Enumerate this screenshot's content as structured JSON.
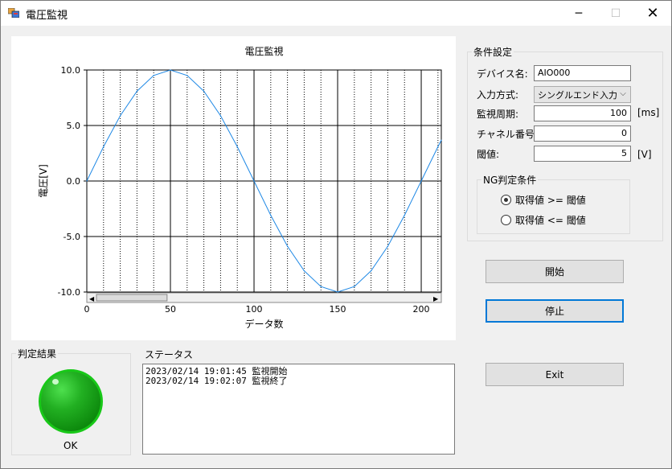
{
  "window": {
    "title": "電圧監視",
    "minimize_glyph": "─",
    "maximize_glyph": "☐",
    "close_glyph": "✕",
    "icon": "app-icon"
  },
  "chart": {
    "title": "電圧監視",
    "xlabel": "データ数",
    "ylabel": "電圧[V]"
  },
  "chart_data": {
    "type": "line",
    "title": "電圧監視",
    "xlabel": "データ数",
    "ylabel": "電圧[V]",
    "xlim": [
      0,
      212
    ],
    "ylim": [
      -10,
      10
    ],
    "x_ticks": [
      "0",
      "50",
      "100",
      "150",
      "200"
    ],
    "y_ticks": [
      "10.0",
      "5.0",
      "0.0",
      "-5.0",
      "-10.0"
    ],
    "grid": true,
    "minor_vertical_grid_every": 10,
    "series": [
      {
        "color": "#1e88e5",
        "x": [
          0,
          10,
          20,
          30,
          40,
          50,
          60,
          70,
          80,
          90,
          100,
          110,
          120,
          130,
          140,
          150,
          160,
          170,
          180,
          190,
          200,
          210,
          212
        ],
        "y": [
          0,
          3.09,
          5.88,
          8.09,
          9.51,
          10.0,
          9.51,
          8.09,
          5.88,
          3.09,
          0,
          -3.09,
          -5.88,
          -8.09,
          -9.51,
          -10.0,
          -9.51,
          -8.09,
          -5.88,
          -3.09,
          0,
          3.09,
          3.68
        ]
      }
    ],
    "scrollbar": {
      "left_arrow": "◀",
      "right_arrow": "▶"
    }
  },
  "settings": {
    "group_title": "条件設定",
    "device_label": "デバイス名:",
    "device_value": "AIO000",
    "input_label": "入力方式:",
    "input_value": "シングルエンド入力",
    "period_label": "監視周期:",
    "period_value": "100",
    "period_unit": "[ms]",
    "channel_label": "チャネル番号:",
    "channel_value": "0",
    "threshold_label": "閾値:",
    "threshold_value": "5",
    "threshold_unit": "[V]",
    "ng_group_title": "NG判定条件",
    "ng_option1": "取得値 >= 閾値",
    "ng_option2": "取得値 <= 閾値",
    "ng_selected": 1
  },
  "buttons": {
    "start": "開始",
    "stop": "停止",
    "exit": "Exit"
  },
  "result": {
    "group_title": "判定結果",
    "lamp_color": "#22b022",
    "text": "OK"
  },
  "status": {
    "label": "ステータス",
    "lines": [
      "2023/02/14 19:01:45 監視開始",
      "2023/02/14 19:02:07 監視終了"
    ]
  }
}
